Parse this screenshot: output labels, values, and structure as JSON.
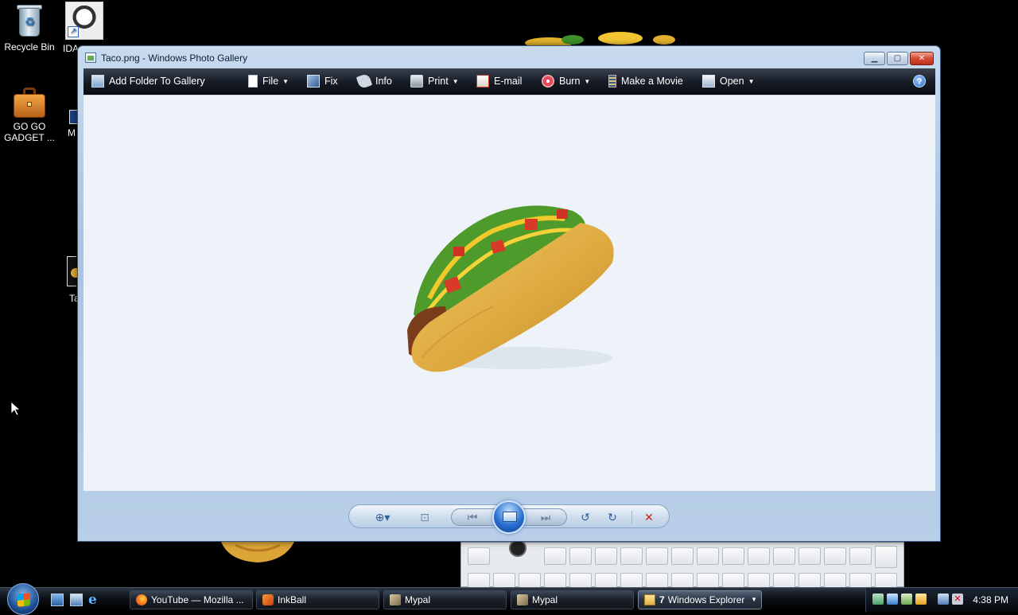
{
  "desktop": {
    "icons": [
      {
        "label": "Recycle Bin"
      },
      {
        "label": "IDA"
      },
      {
        "label": "GO GO\nGADGET ..."
      },
      {
        "label": "M"
      },
      {
        "label": "Ta"
      }
    ]
  },
  "window": {
    "title": "Taco.png - Windows Photo Gallery",
    "toolbar": {
      "add_folder": "Add Folder To Gallery",
      "file": "File",
      "fix": "Fix",
      "info": "Info",
      "print": "Print",
      "email": "E-mail",
      "burn": "Burn",
      "make_movie": "Make a Movie",
      "open": "Open",
      "help": "?"
    },
    "image_alt": "Taco"
  },
  "taskbar": {
    "tasks": [
      {
        "label": "YouTube — Mozilla ..."
      },
      {
        "label": "InkBall"
      },
      {
        "label": "Mypal"
      },
      {
        "label": "Mypal"
      },
      {
        "label": "Windows Explorer",
        "count": "7"
      }
    ],
    "clock": "4:38 PM"
  }
}
